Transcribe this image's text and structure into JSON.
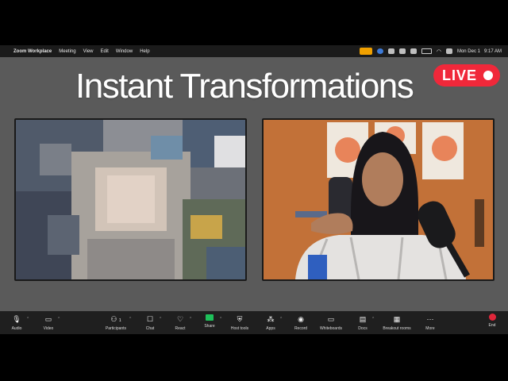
{
  "menubar": {
    "app": "Zoom Workplace",
    "menus": [
      "Meeting",
      "View",
      "Edit",
      "Window",
      "Help"
    ],
    "clock": "Mon Dec 1   9:17 AM"
  },
  "headline": "Instant Transformations",
  "live_badge": "LIVE",
  "toolbar": {
    "audio": "Audio",
    "video": "Video",
    "participants": "Participants",
    "participants_count": "1",
    "chat": "Chat",
    "react": "React",
    "share": "Share",
    "host_tools": "Host tools",
    "apps": "Apps",
    "record": "Record",
    "whiteboards": "Whiteboards",
    "docs": "Docs",
    "breakout_rooms": "Breakout rooms",
    "more": "More",
    "end": "End"
  },
  "colors": {
    "live_red": "#f0283a",
    "share_green": "#1ec05a",
    "end_red": "#e0263a",
    "stage_gray": "#5a5a5a"
  },
  "icons": [
    "apple-icon",
    "mic-icon",
    "camera-icon",
    "participants-icon",
    "chat-icon",
    "react-icon",
    "share-icon",
    "host-tools-icon",
    "apps-icon",
    "record-icon",
    "whiteboards-icon",
    "docs-icon",
    "breakout-rooms-icon",
    "more-icon",
    "end-icon"
  ]
}
